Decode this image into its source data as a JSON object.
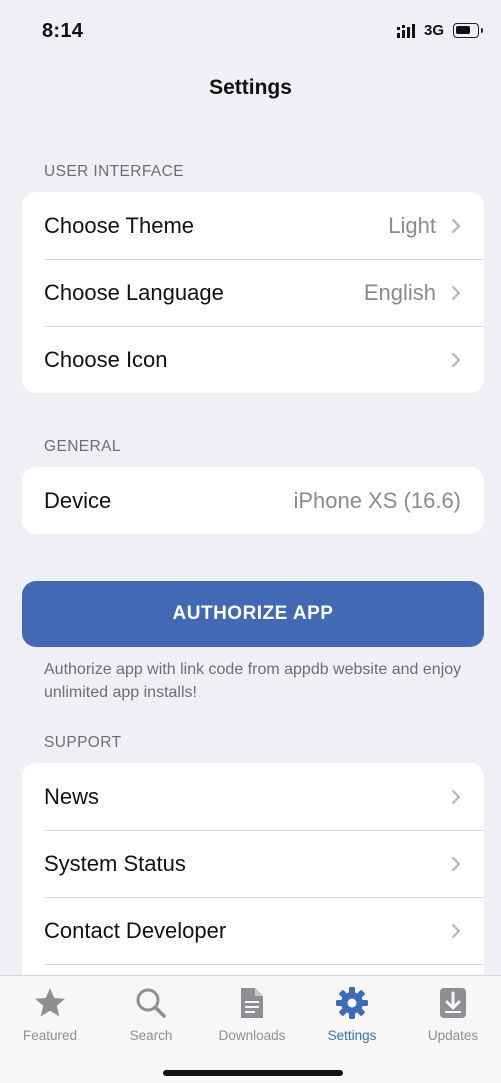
{
  "status_bar": {
    "time": "8:14",
    "network": "3G"
  },
  "nav": {
    "title": "Settings"
  },
  "sections": {
    "user_interface": {
      "header": "USER INTERFACE",
      "rows": [
        {
          "label": "Choose Theme",
          "value": "Light"
        },
        {
          "label": "Choose Language",
          "value": "English"
        },
        {
          "label": "Choose Icon",
          "value": ""
        }
      ]
    },
    "general": {
      "header": "GENERAL",
      "rows": [
        {
          "label": "Device",
          "value": "iPhone XS (16.6)"
        }
      ]
    },
    "support": {
      "header": "SUPPORT",
      "rows": [
        {
          "label": "News"
        },
        {
          "label": "System Status"
        },
        {
          "label": "Contact Developer"
        }
      ]
    }
  },
  "authorize": {
    "button_label": "AUTHORIZE APP",
    "note": "Authorize app with link code from appdb website and enjoy unlimited app installs!"
  },
  "tab_bar": {
    "active": "Settings",
    "accent_color": "#3f6ab5",
    "inactive_color": "#8e8e93",
    "tabs": [
      {
        "label": "Featured",
        "icon": "star-icon"
      },
      {
        "label": "Search",
        "icon": "search-icon"
      },
      {
        "label": "Downloads",
        "icon": "document-icon"
      },
      {
        "label": "Settings",
        "icon": "gear-icon"
      },
      {
        "label": "Updates",
        "icon": "download-tray-icon"
      }
    ]
  },
  "colors": {
    "background": "#efeff4",
    "button": "#4269b3"
  }
}
